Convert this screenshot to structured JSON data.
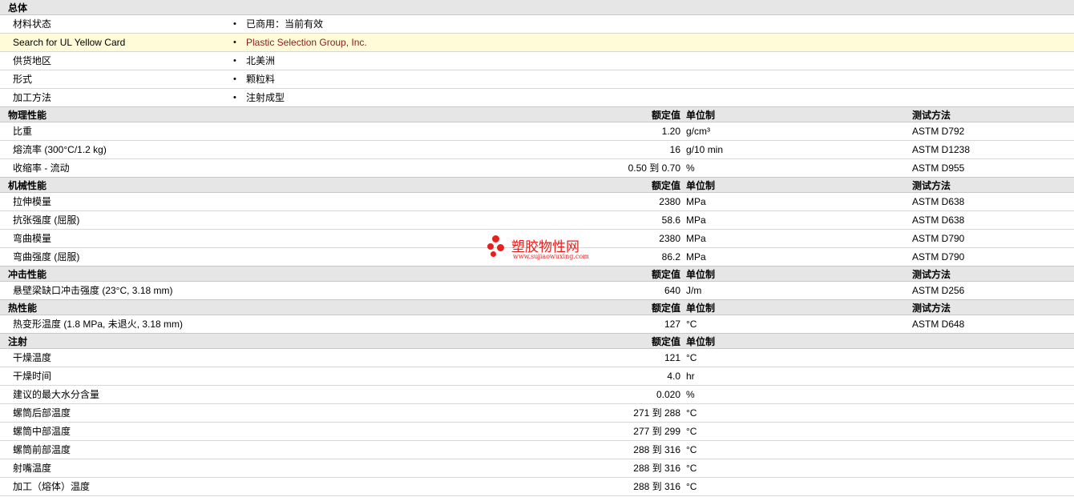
{
  "sections": [
    {
      "title": "总体",
      "header": null,
      "rows": [
        {
          "label": "材料状态",
          "value": "已商用：当前有效"
        },
        {
          "label": "Search for UL Yellow Card",
          "value": "Plastic Selection Group, Inc.",
          "link": true,
          "highlight": true
        },
        {
          "label": "供货地区",
          "value": "北美洲"
        },
        {
          "label": "形式",
          "value": "颗粒料"
        },
        {
          "label": "加工方法",
          "value": "注射成型"
        }
      ]
    },
    {
      "title": "物理性能",
      "header": {
        "nominal": "额定值",
        "unit": "单位制",
        "method": "测试方法"
      },
      "rows": [
        {
          "label": "比重",
          "nominal": "1.20",
          "unit": "g/cm³",
          "method": "ASTM D792"
        },
        {
          "label": "熔流率  (300°C/1.2 kg)",
          "nominal": "16",
          "unit": "g/10 min",
          "method": "ASTM D1238"
        },
        {
          "label": "收缩率  - 流动",
          "nominal": "0.50 到  0.70",
          "unit": "%",
          "method": "ASTM D955"
        }
      ]
    },
    {
      "title": "机械性能",
      "header": {
        "nominal": "额定值",
        "unit": "单位制",
        "method": "测试方法"
      },
      "rows": [
        {
          "label": "拉伸模量",
          "nominal": "2380",
          "unit": "MPa",
          "method": "ASTM D638"
        },
        {
          "label": "抗张强度  (屈服)",
          "nominal": "58.6",
          "unit": "MPa",
          "method": "ASTM D638"
        },
        {
          "label": "弯曲模量",
          "nominal": "2380",
          "unit": "MPa",
          "method": "ASTM D790"
        },
        {
          "label": "弯曲强度  (屈服)",
          "nominal": "86.2",
          "unit": "MPa",
          "method": "ASTM D790"
        }
      ]
    },
    {
      "title": "冲击性能",
      "header": {
        "nominal": "额定值",
        "unit": "单位制",
        "method": "测试方法"
      },
      "rows": [
        {
          "label": "悬壁梁缺口冲击强度  (23°C, 3.18 mm)",
          "nominal": "640",
          "unit": "J/m",
          "method": "ASTM D256"
        }
      ]
    },
    {
      "title": "热性能",
      "header": {
        "nominal": "额定值",
        "unit": "单位制",
        "method": "测试方法"
      },
      "rows": [
        {
          "label": "热变形温度  (1.8 MPa, 未退火, 3.18 mm)",
          "nominal": "127",
          "unit": "°C",
          "method": "ASTM D648"
        }
      ]
    },
    {
      "title": "注射",
      "header": {
        "nominal": "额定值",
        "unit": "单位制",
        "method": ""
      },
      "rows": [
        {
          "label": "干燥温度",
          "nominal": "121",
          "unit": "°C",
          "method": ""
        },
        {
          "label": "干燥时间",
          "nominal": "4.0",
          "unit": "hr",
          "method": ""
        },
        {
          "label": "建议的最大水分含量",
          "nominal": "0.020",
          "unit": "%",
          "method": ""
        },
        {
          "label": "螺筒后部温度",
          "nominal": "271 到  288",
          "unit": "°C",
          "method": ""
        },
        {
          "label": "螺筒中部温度",
          "nominal": "277 到  299",
          "unit": "°C",
          "method": ""
        },
        {
          "label": "螺筒前部温度",
          "nominal": "288 到  316",
          "unit": "°C",
          "method": ""
        },
        {
          "label": "射嘴温度",
          "nominal": "288 到  316",
          "unit": "°C",
          "method": ""
        },
        {
          "label": "加工（熔体）温度",
          "nominal": "288 到  316",
          "unit": "°C",
          "method": ""
        }
      ]
    }
  ],
  "bullet": "•",
  "watermark": {
    "title": "塑胶物性网",
    "url": "www.sujiaowuxing.com",
    "color": "#e8201c"
  }
}
